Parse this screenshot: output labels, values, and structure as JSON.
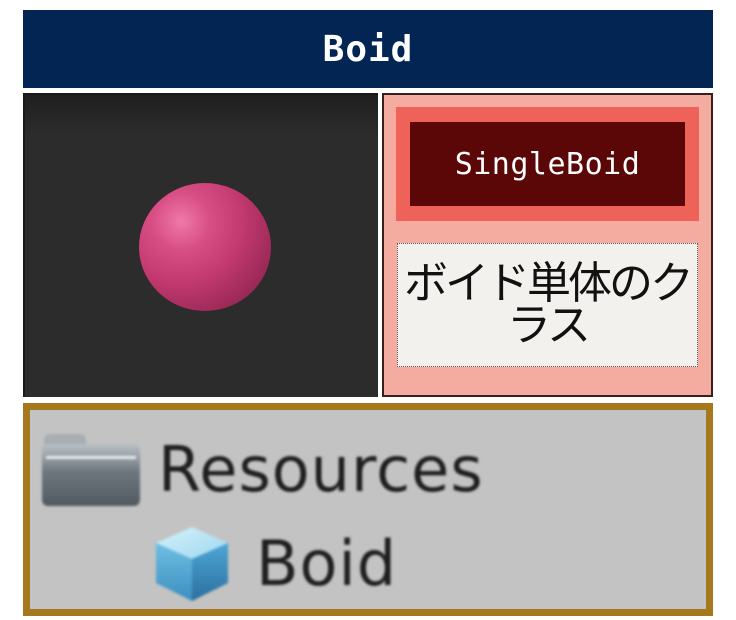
{
  "header": {
    "title": "Boid"
  },
  "preview": {
    "object": "pink-sphere",
    "sphere_color": "#c0386e",
    "background_color": "#2c2c2c"
  },
  "info": {
    "class_name": "SingleBoid",
    "description": "ボイド単体のクラス",
    "colors": {
      "panel": "#f4aca1",
      "class_outer": "#ef6259",
      "class_inner": "#5b0707"
    }
  },
  "hierarchy": {
    "folder": {
      "label": "Resources",
      "icon": "folder-icon"
    },
    "asset": {
      "label": "Boid",
      "icon": "prefab-cube-icon"
    },
    "border_color": "#a6781e"
  }
}
